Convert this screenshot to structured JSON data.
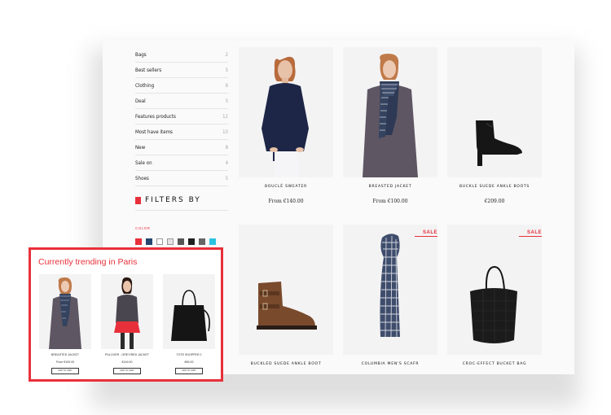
{
  "sidebar": {
    "categories": [
      {
        "label": "Bags",
        "count": "2"
      },
      {
        "label": "Best sellers",
        "count": "5"
      },
      {
        "label": "Clothing",
        "count": "6"
      },
      {
        "label": "Deal",
        "count": "5"
      },
      {
        "label": "Features products",
        "count": "12"
      },
      {
        "label": "Most have items",
        "count": "10"
      },
      {
        "label": "New",
        "count": "8"
      },
      {
        "label": "Sale on",
        "count": "4"
      },
      {
        "label": "Shoes",
        "count": "5"
      }
    ],
    "filters_title": "FILTERS BY",
    "color_label": "COLOR",
    "swatches": [
      "#e8303a",
      "#24466f",
      "#ffffff",
      "#e6e2e4",
      "#555555",
      "#1f1f1f",
      "#666666",
      "#2bc4e0"
    ]
  },
  "products": [
    {
      "name": "BOUCLÉ SWEATER",
      "price": "From €140.00",
      "sale": ""
    },
    {
      "name": "BREASTED JACKET",
      "price": "From €100.00",
      "sale": ""
    },
    {
      "name": "BUCKLE SUEDE ANKLE BOOTS",
      "price": "€209.00",
      "sale": ""
    },
    {
      "name": "BUCKLED SUEDE ANKLE BOOT",
      "price": "",
      "sale": ""
    },
    {
      "name": "COLUMBIA MEN'S SCAFR",
      "price": "",
      "sale": "SALE"
    },
    {
      "name": "CROC-EFFECT BUCKET BAG",
      "price": "",
      "sale": "SALE"
    }
  ],
  "trending": {
    "title": "Currently trending in Paris",
    "items": [
      {
        "name": "BREASTED JACKET",
        "price": "From €100.00",
        "button": "ADD TO CART"
      },
      {
        "name": "PULOVER - GREY/RED JACKET",
        "price": "€149.00",
        "button": "ADD TO CART"
      },
      {
        "name": "TOTE SHOPPER 2",
        "price": "€89.00",
        "button": "ADD TO CART"
      }
    ]
  }
}
